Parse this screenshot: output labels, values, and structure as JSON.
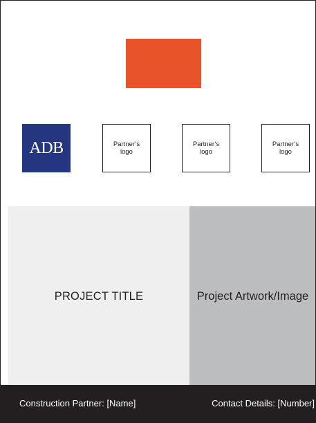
{
  "colors": {
    "accent_block": "#e8532a",
    "adb_blue": "#253680",
    "title_panel_bg": "#efefef",
    "artwork_panel_bg": "#bcbdbe",
    "footer_bg": "#231f20"
  },
  "logos": {
    "adb": "ADB",
    "partners": [
      "Partner’s\nlogo",
      "Partner’s\nlogo",
      "Partner’s\nlogo"
    ]
  },
  "panels": {
    "title": "PROJECT TITLE",
    "artwork": "Project Artwork/Image"
  },
  "footer": {
    "construction_partner": "Construction Partner: [Name]",
    "contact_details": "Contact Details: [Number]"
  }
}
